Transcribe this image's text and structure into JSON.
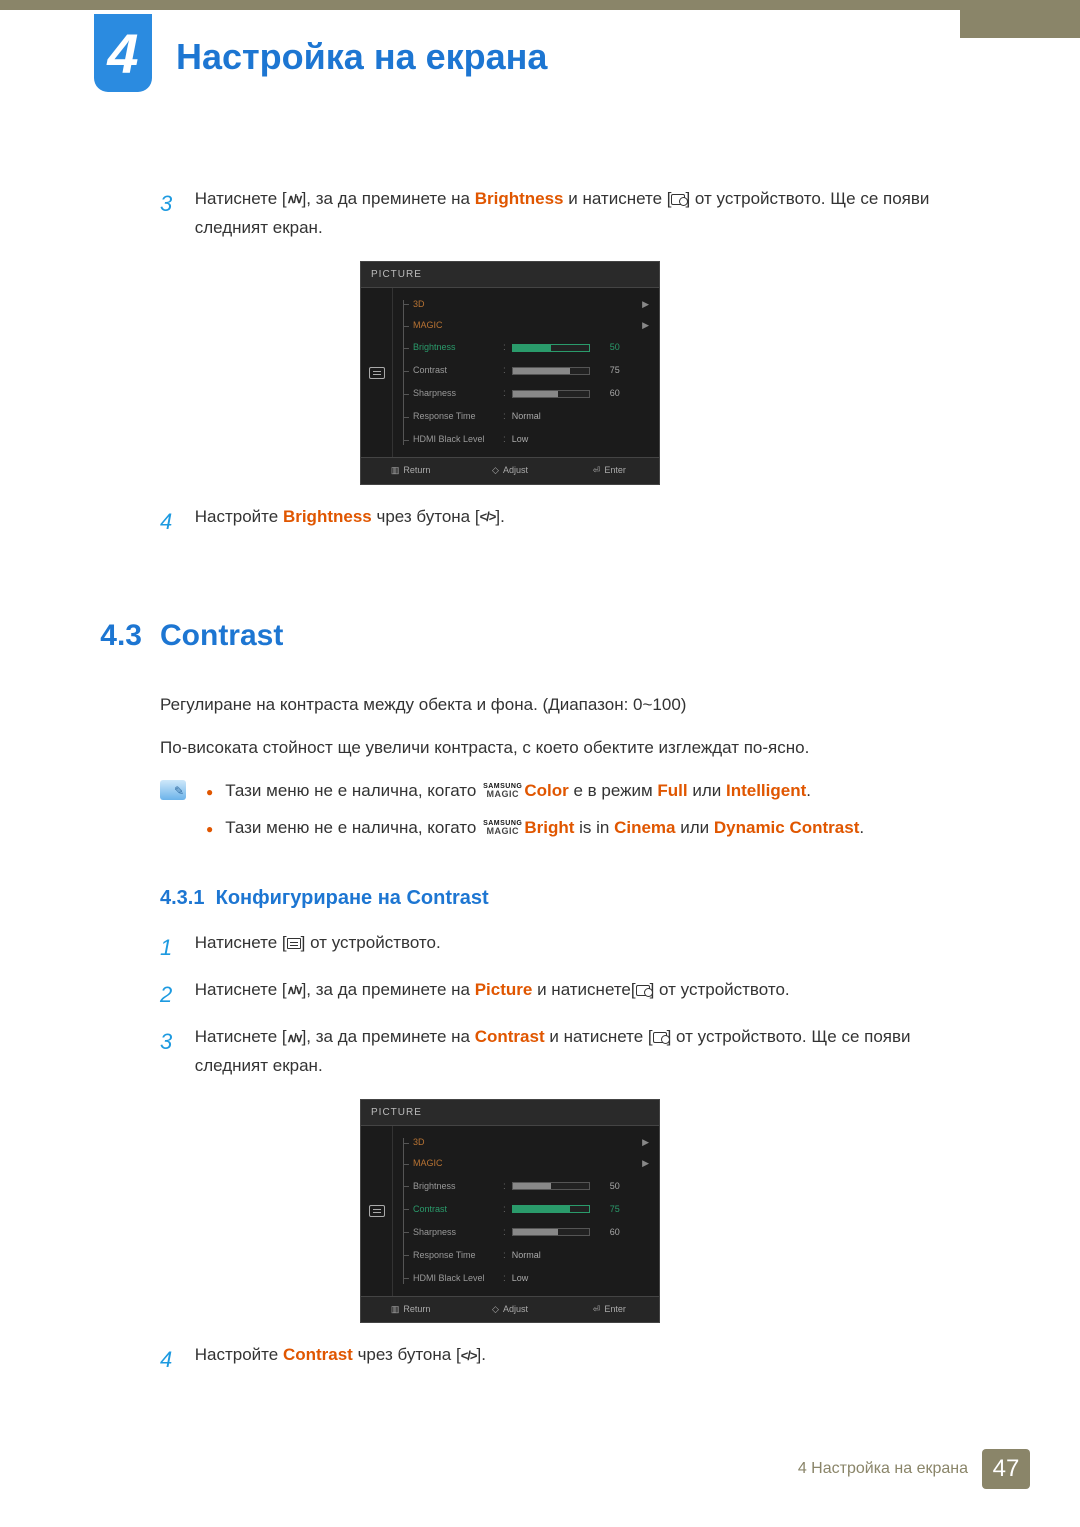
{
  "chapter": {
    "num": "4",
    "title": "Настройка на екрана"
  },
  "steps_top": {
    "s3_a": "Натиснете [",
    "s3_b": "], за да преминете на ",
    "s3_hl": "Brightness",
    "s3_c": " и натиснете [",
    "s3_d": "] от устройството. Ще се появи следният екран.",
    "s4_a": "Настройте ",
    "s4_hl": "Brightness",
    "s4_b": " чрез бутона [",
    "s4_c": "]."
  },
  "icons": {
    "updown": "∧/∨",
    "lr": "</>"
  },
  "osd1": {
    "title": "PICTURE",
    "rows": [
      {
        "label": "3D",
        "type": "arrow"
      },
      {
        "label": "MAGIC",
        "type": "arrow"
      },
      {
        "label": "Brightness",
        "type": "bar",
        "value": 50,
        "selected": true
      },
      {
        "label": "Contrast",
        "type": "bar",
        "value": 75
      },
      {
        "label": "Sharpness",
        "type": "bar",
        "value": 60
      },
      {
        "label": "Response Time",
        "type": "text",
        "text": "Normal"
      },
      {
        "label": "HDMI Black Level",
        "type": "text",
        "text": "Low"
      }
    ],
    "footer": {
      "return": "Return",
      "adjust": "Adjust",
      "enter": "Enter"
    }
  },
  "section": {
    "num": "4.3",
    "title": "Contrast"
  },
  "para1": "Регулиране на контраста между обекта и фона. (Диапазон: 0~100)",
  "para2": "По-високата стойност ще увеличи контраста, с което обектите изглеждат по-ясно.",
  "notes": {
    "l1_a": "Тази меню не е налична, когато ",
    "l1_mode": "Color",
    "l1_b": " е в режим ",
    "l1_v1": "Full",
    "l1_or": " или ",
    "l1_v2": "Intelligent",
    "l2_a": "Тази меню не е налична, когато ",
    "l2_mode": "Bright",
    "l2_b": " is in ",
    "l2_v1": "Cinema",
    "l2_or": " или ",
    "l2_v2": "Dynamic Contrast"
  },
  "subsection": {
    "num": "4.3.1",
    "title": "Конфигуриране на Contrast"
  },
  "steps_bottom": {
    "s1_a": "Натиснете [",
    "s1_b": "] от устройството.",
    "s2_a": "Натиснете [",
    "s2_b": "], за да преминете на ",
    "s2_hl": "Picture",
    "s2_c": " и натиснете[",
    "s2_d": "] от устройството.",
    "s3_a": "Натиснете [",
    "s3_b": "], за да преминете на ",
    "s3_hl": "Contrast",
    "s3_c": " и натиснете [",
    "s3_d": "] от устройството. Ще се появи следният екран.",
    "s4_a": "Настройте ",
    "s4_hl": "Contrast",
    "s4_b": " чрез бутона [",
    "s4_c": "]."
  },
  "osd2": {
    "title": "PICTURE",
    "rows": [
      {
        "label": "3D",
        "type": "arrow"
      },
      {
        "label": "MAGIC",
        "type": "arrow"
      },
      {
        "label": "Brightness",
        "type": "bar",
        "value": 50
      },
      {
        "label": "Contrast",
        "type": "bar",
        "value": 75,
        "selected": true
      },
      {
        "label": "Sharpness",
        "type": "bar",
        "value": 60
      },
      {
        "label": "Response Time",
        "type": "text",
        "text": "Normal"
      },
      {
        "label": "HDMI Black Level",
        "type": "text",
        "text": "Low"
      }
    ],
    "footer": {
      "return": "Return",
      "adjust": "Adjust",
      "enter": "Enter"
    }
  },
  "footer": {
    "text": "4 Настройка на екрана",
    "page": "47"
  },
  "magic": {
    "top": "SAMSUNG",
    "bot": "MAGIC"
  }
}
